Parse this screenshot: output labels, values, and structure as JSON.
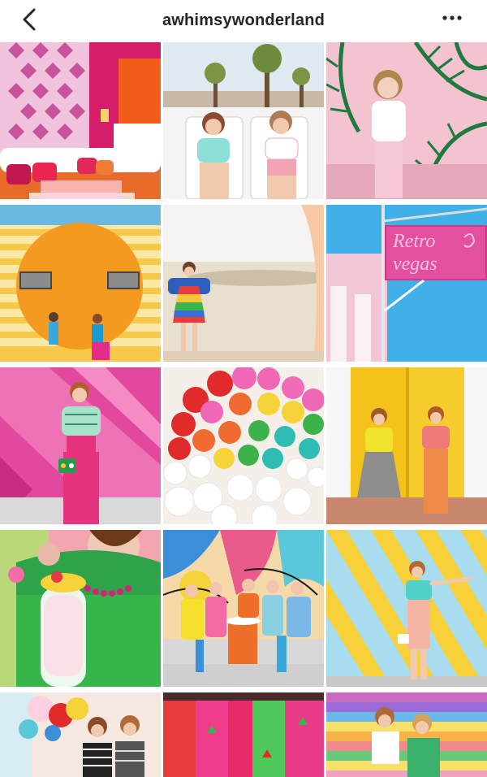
{
  "header": {
    "username": "awhimsywonderland",
    "back_icon": "chevron-left-icon",
    "more_icon": "ellipsis-icon"
  },
  "grid": {
    "posts": [
      {
        "id": 1,
        "subject": "pink lounge with pink wallpaper and orange art"
      },
      {
        "id": 2,
        "subject": "two women on lounge chairs under palm trees"
      },
      {
        "id": 3,
        "subject": "woman by green leaf mural"
      },
      {
        "id": 4,
        "subject": "yellow striped wall with sun face"
      },
      {
        "id": 5,
        "subject": "woman in rainbow dress in desert"
      },
      {
        "id": 6,
        "subject": "Retro Vegas sign"
      },
      {
        "id": 7,
        "subject": "woman against pink wall"
      },
      {
        "id": 8,
        "subject": "balloon rainbow"
      },
      {
        "id": 9,
        "subject": "two women at yellow doors"
      },
      {
        "id": 10,
        "subject": "green top with drink"
      },
      {
        "id": 11,
        "subject": "group on bench with colorful mural"
      },
      {
        "id": 12,
        "subject": "woman at yellow diagonal stripe wall"
      },
      {
        "id": 13,
        "subject": "two women with balloons"
      },
      {
        "id": 14,
        "subject": "colorful painted wall"
      },
      {
        "id": 15,
        "subject": "two women on rainbow stairs"
      }
    ]
  },
  "colors": {
    "title_text": "#262626",
    "background": "#ffffff"
  }
}
